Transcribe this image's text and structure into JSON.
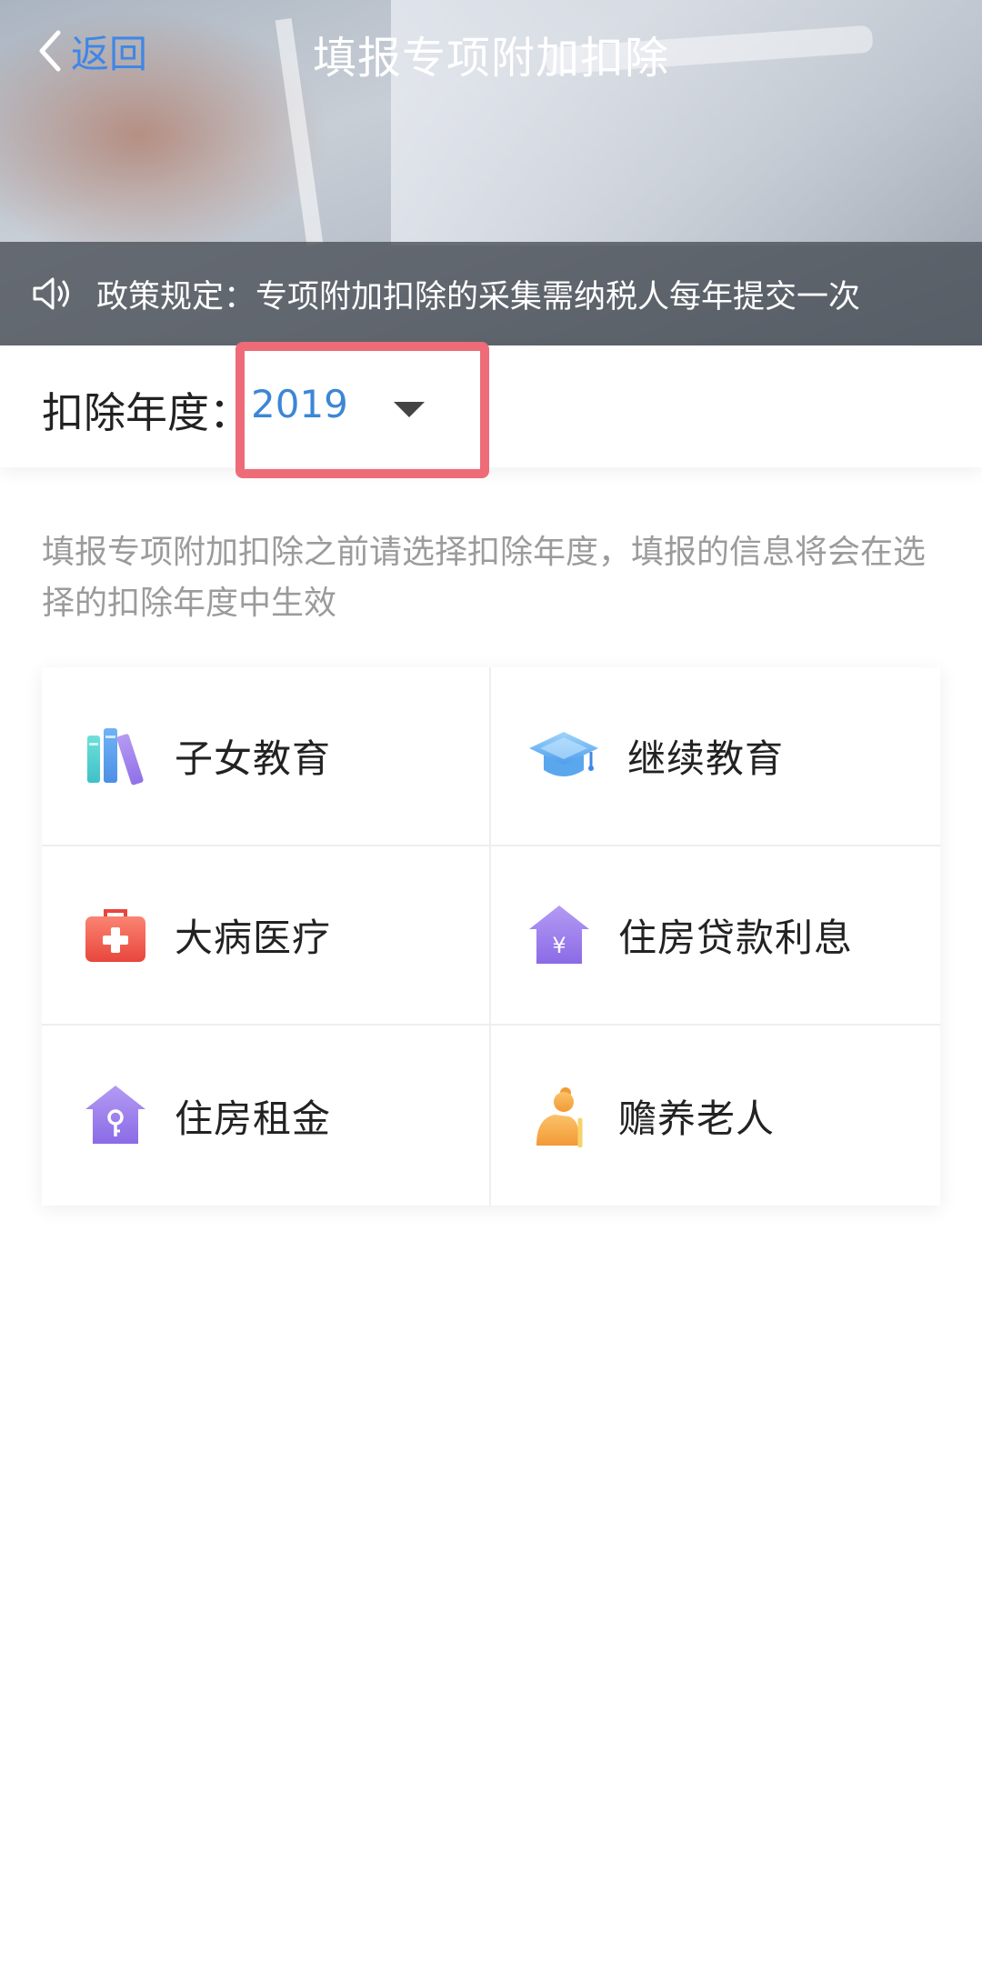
{
  "nav": {
    "back_label": "返回",
    "title": "填报专项附加扣除"
  },
  "notice": {
    "icon": "speaker-icon",
    "text": "政策规定：专项附加扣除的采集需纳税人每年提交一次"
  },
  "year": {
    "label": "扣除年度：",
    "selected": "2019",
    "highlight_color": "#ee6b78"
  },
  "hint": "填报专项附加扣除之前请选择扣除年度，填报的信息将会在选择的扣除年度中生效",
  "categories": [
    {
      "label": "子女教育",
      "icon": "books-icon"
    },
    {
      "label": "继续教育",
      "icon": "graduation-cap-icon"
    },
    {
      "label": "大病医疗",
      "icon": "medical-kit-icon"
    },
    {
      "label": "住房贷款利息",
      "icon": "house-yuan-icon"
    },
    {
      "label": "住房租金",
      "icon": "house-key-icon"
    },
    {
      "label": "赡养老人",
      "icon": "elderly-person-icon"
    }
  ],
  "colors": {
    "accent_blue": "#3f87e6",
    "year_blue": "#3c86d6",
    "hint_gray": "#9b9b9b",
    "purple": "#9b7ae8",
    "red": "#ee5a4e",
    "orange": "#f4a53e"
  }
}
